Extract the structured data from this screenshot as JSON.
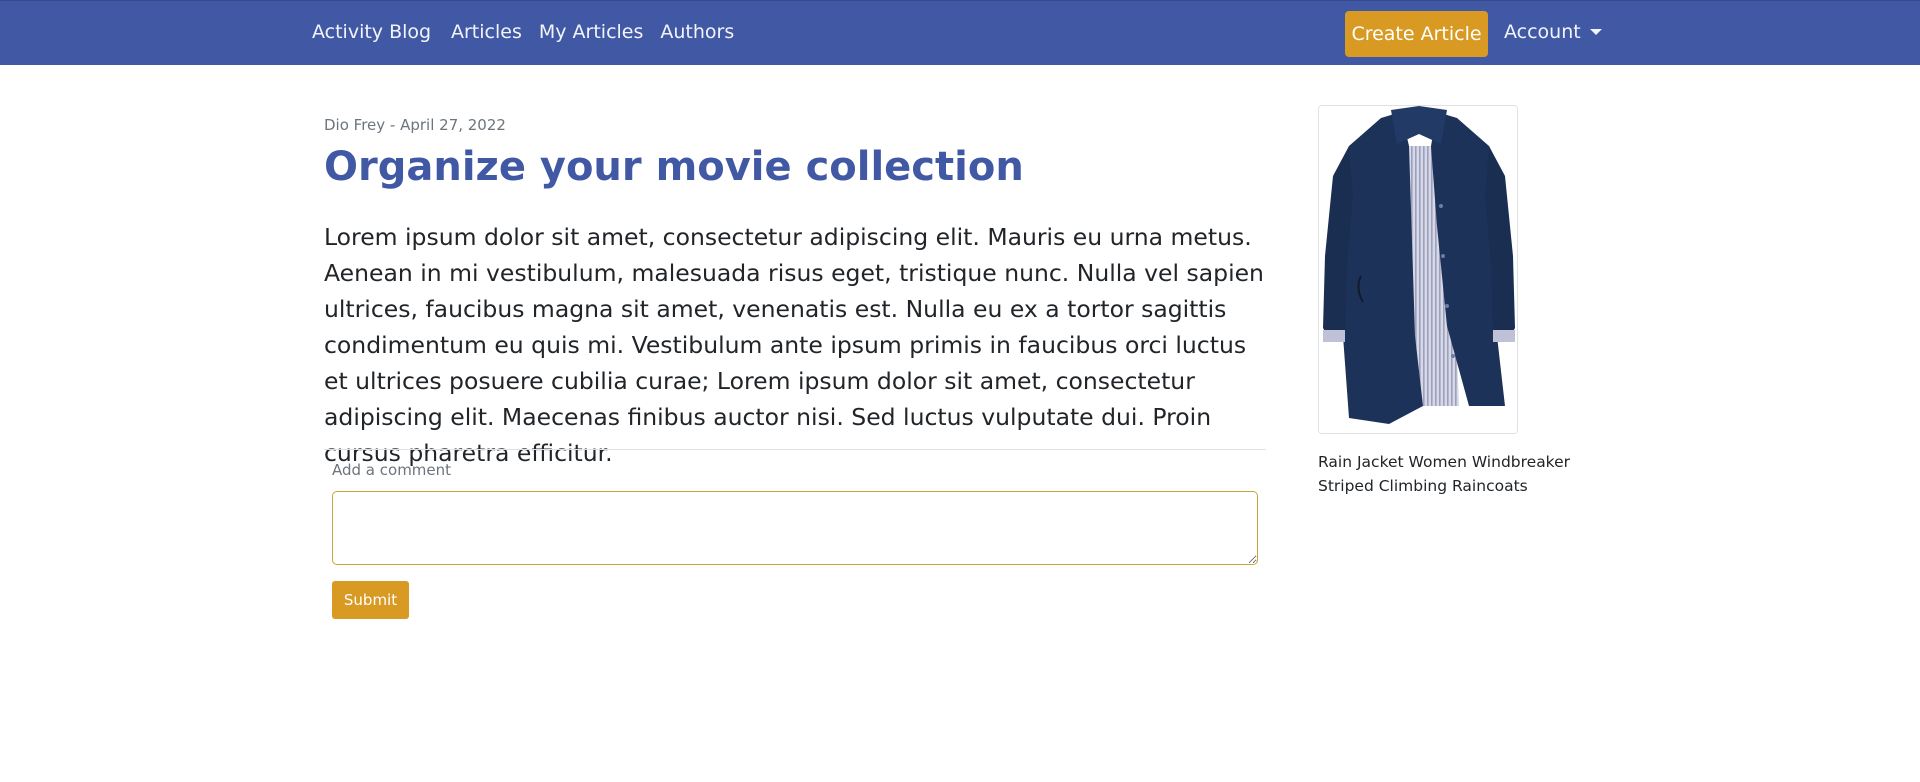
{
  "navbar": {
    "brand": "Activity Blog",
    "links": [
      "Articles",
      "My Articles",
      "Authors"
    ],
    "create_label": "Create Article",
    "account_label": "Account"
  },
  "article": {
    "meta": "Dio Frey - April 27, 2022",
    "title": "Organize your movie collection",
    "body": "Lorem ipsum dolor sit amet, consectetur adipiscing elit. Mauris eu urna metus. Aenean in mi vestibulum, malesuada risus eget, tristique nunc. Nulla vel sapien ultrices, faucibus magna sit amet, venenatis est. Nulla eu ex a tortor sagittis condimentum eu quis mi. Vestibulum ante ipsum primis in faucibus orci luctus et ultrices posuere cubilia curae; Lorem ipsum dolor sit amet, consectetur adipiscing elit. Maecenas finibus auctor nisi. Sed luctus vulputate dui. Proin cursus pharetra efficitur."
  },
  "comment": {
    "label": "Add a comment",
    "value": "",
    "submit_label": "Submit"
  },
  "sidebar": {
    "product_name": "Rain Jacket Women Windbreaker Striped Climbing Raincoats"
  },
  "colors": {
    "navbar": "#4159a4",
    "accent": "#d89a22",
    "title": "#4159a4"
  }
}
